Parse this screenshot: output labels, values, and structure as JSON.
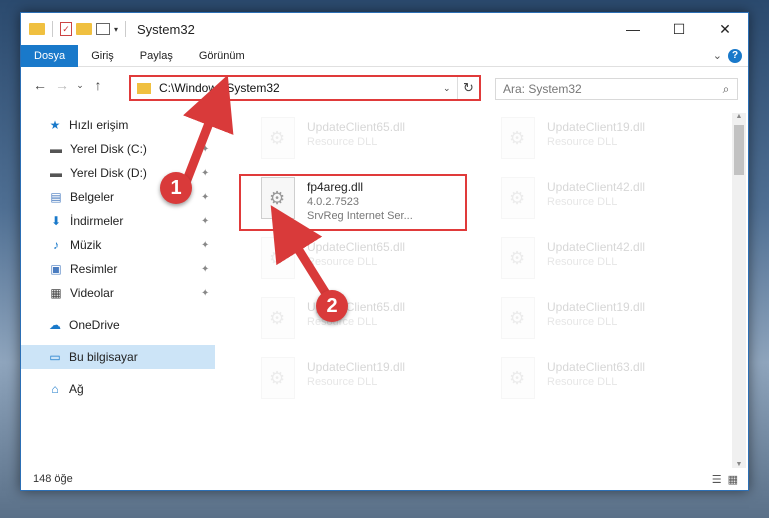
{
  "window": {
    "title": "System32"
  },
  "window_controls": {
    "minimize": "—",
    "maximize": "☐",
    "close": "✕"
  },
  "ribbon": {
    "tabs": [
      {
        "label": "Dosya",
        "active": true
      },
      {
        "label": "Giriş"
      },
      {
        "label": "Paylaş"
      },
      {
        "label": "Görünüm"
      }
    ]
  },
  "address": {
    "path": "C:\\Windows\\System32"
  },
  "search": {
    "placeholder": "Ara: System32"
  },
  "sidebar": {
    "quick_access": "Hızlı erişim",
    "items": [
      {
        "label": "Yerel Disk (C:)",
        "icon": "drive-icon"
      },
      {
        "label": "Yerel Disk (D:)",
        "icon": "drive-icon"
      },
      {
        "label": "Belgeler",
        "icon": "documents-icon"
      },
      {
        "label": "İndirmeler",
        "icon": "downloads-icon"
      },
      {
        "label": "Müzik",
        "icon": "music-icon"
      },
      {
        "label": "Resimler",
        "icon": "pictures-icon"
      },
      {
        "label": "Videolar",
        "icon": "videos-icon"
      }
    ],
    "onedrive": "OneDrive",
    "this_pc": "Bu bilgisayar",
    "network": "Ağ"
  },
  "files": {
    "selected": {
      "name": "fp4areg.dll",
      "version": "4.0.2.7523",
      "description": "SrvReg Internet Ser..."
    },
    "background": [
      {
        "name": "UpdateClient65.dll",
        "type": "Resource DLL"
      },
      {
        "name": "UpdateClient19.dll",
        "type": "Resource DLL"
      },
      {
        "name": "UpdateClient42.dll",
        "type": "Resource DLL"
      },
      {
        "name": "UpdateClient65.dll",
        "type": "Resource DLL"
      },
      {
        "name": "UpdateClient42.dll",
        "type": "Resource DLL"
      },
      {
        "name": "UpdateClient65.dll",
        "type": "Resource DLL"
      },
      {
        "name": "UpdateClient19.dll",
        "type": "Resource DLL"
      },
      {
        "name": "UpdateClient19.dll",
        "type": "Resource DLL"
      },
      {
        "name": "UpdateClient63.dll",
        "type": "Resource DLL"
      }
    ]
  },
  "status": {
    "count": "148 öğe"
  },
  "markers": {
    "one": "1",
    "two": "2"
  },
  "colors": {
    "accent": "#1979ca",
    "highlight": "#e03a3a"
  }
}
